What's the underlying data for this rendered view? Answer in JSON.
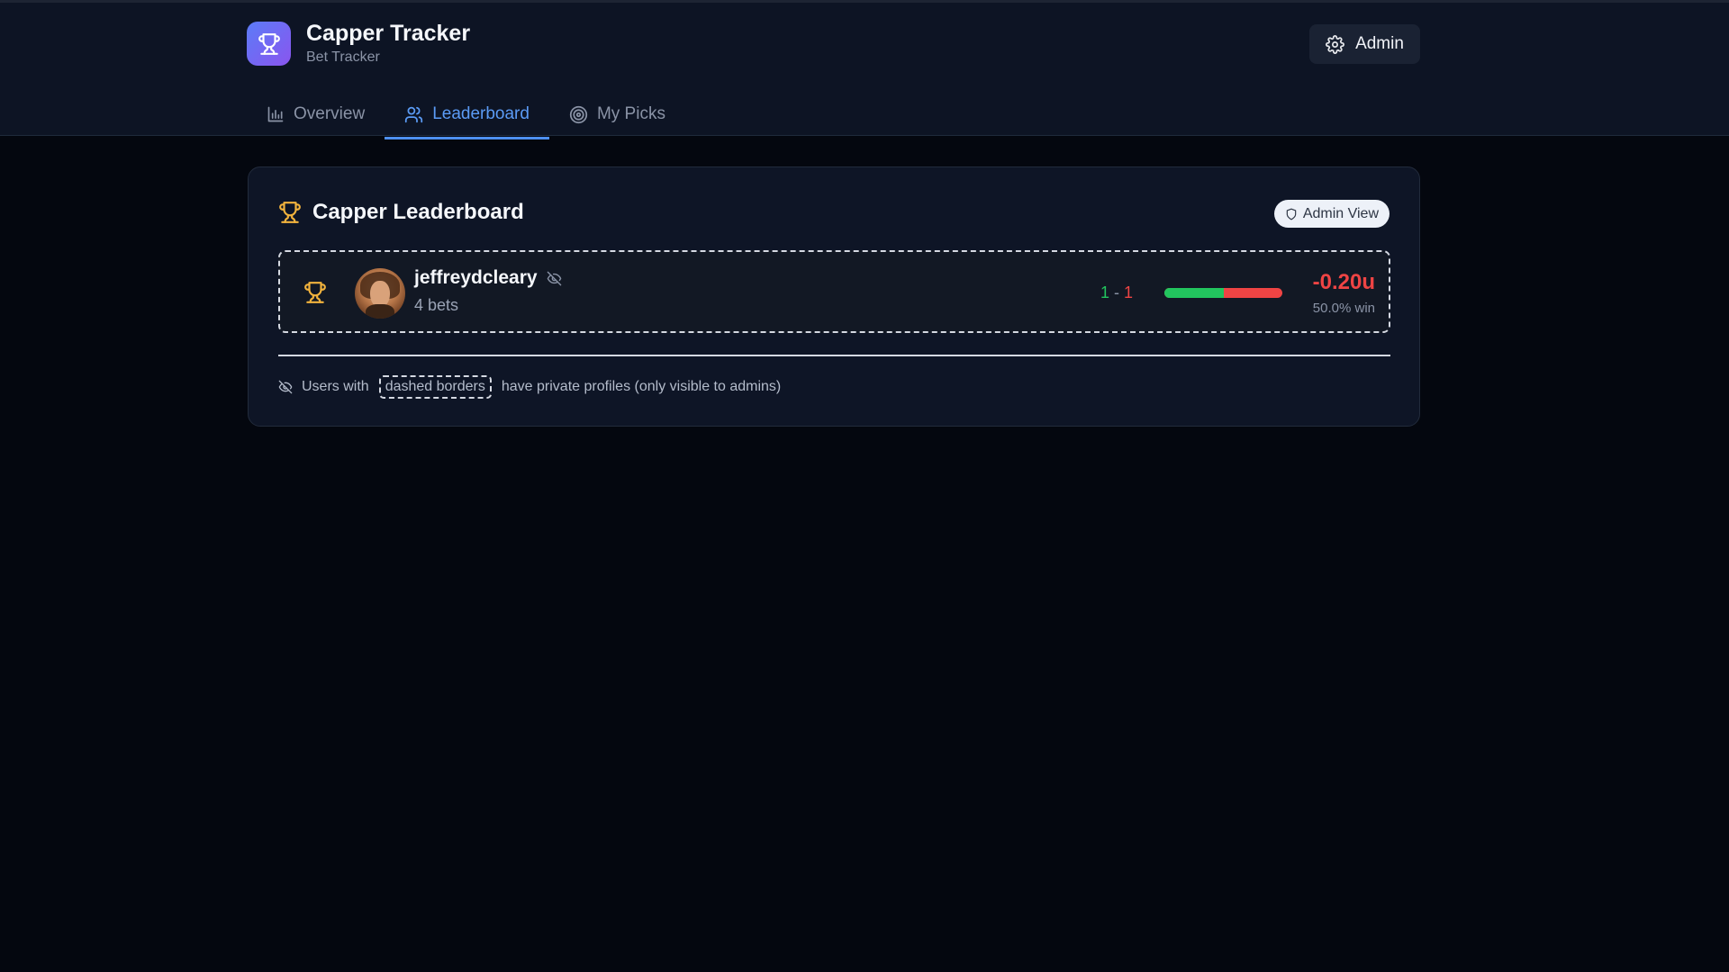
{
  "header": {
    "app_title": "Capper Tracker",
    "app_subtitle": "Bet Tracker",
    "admin_label": "Admin"
  },
  "tabs": [
    {
      "label": "Overview",
      "icon": "bar-chart-icon",
      "active": false
    },
    {
      "label": "Leaderboard",
      "icon": "users-icon",
      "active": true
    },
    {
      "label": "My Picks",
      "icon": "target-icon",
      "active": false
    }
  ],
  "leaderboard": {
    "title": "Capper Leaderboard",
    "badge": "Admin View",
    "entries": [
      {
        "username": "jeffreydcleary",
        "bets": "4 bets",
        "wins": "1",
        "separator": "-",
        "losses": "1",
        "win_fraction": 0.5,
        "units": "-0.20u",
        "win_pct": "50.0% win",
        "private": true
      }
    ],
    "footnote": {
      "prefix": "Users with",
      "sample": "dashed borders",
      "suffix": "have private profiles (only visible to admins)"
    }
  },
  "colors": {
    "accent": "#4d8fef",
    "win": "#22c55e",
    "loss": "#ef4444",
    "trophy": "#f2b33d",
    "logo_gradient": [
      "#5b7cf7",
      "#8a55ef"
    ]
  }
}
